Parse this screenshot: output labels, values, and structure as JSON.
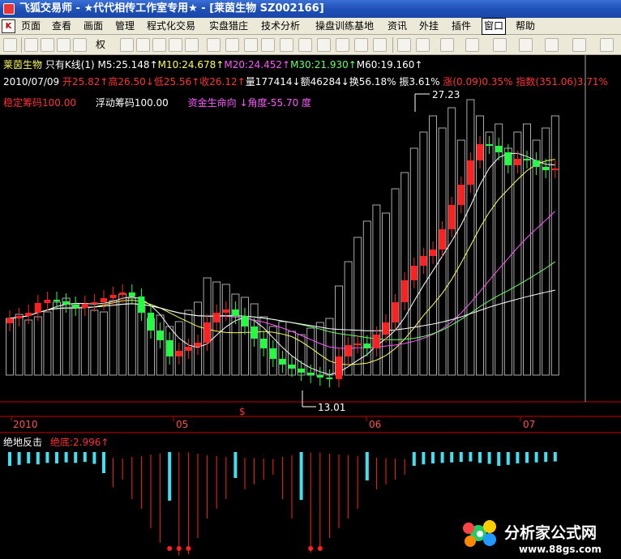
{
  "window": {
    "title": "飞狐交易师 - ★代代相传工作室专用★ - [莱茵生物 SZ002166]"
  },
  "menu": {
    "logo_text": "K",
    "items": [
      "页面",
      "查看",
      "画面",
      "管理",
      "程式化交易",
      "实盘猎庄",
      "技术分析",
      "操盘训练基地",
      "资讯",
      "外挂",
      "插件",
      "窗口",
      "帮助"
    ]
  },
  "toolbar": {
    "quan_label": "权",
    "icons": [
      "open-icon",
      "rsi-icon",
      "crosshair-icon",
      "move-icon",
      "weight-icon",
      "zoom-in-icon",
      "zoom-out-icon",
      "chart-icon",
      "bar-icon",
      "alarm-icon",
      "lock-icon",
      "paint-icon",
      "box-icon",
      "table-icon",
      "picture-icon",
      "cursor-icon",
      "line-icon",
      "ray-icon",
      "bars-icon",
      "fan-icon",
      "gann-icon",
      "arrow-icon",
      "rect-icon",
      "ellipse-icon",
      "pen-icon"
    ]
  },
  "stock": {
    "name": "莱茵生物",
    "mode": "只有K线(1)",
    "ma": [
      {
        "label": "M5:25.148↑",
        "color": "#ffffff"
      },
      {
        "label": "M10:24.678↑",
        "color": "#ffff50"
      },
      {
        "label": "M20:24.452↑",
        "color": "#ff55ff"
      },
      {
        "label": "M30:21.930↑",
        "color": "#66ff66"
      },
      {
        "label": "M60:19.160↑",
        "color": "#ffffff"
      }
    ]
  },
  "quote": {
    "date": "2010/07/09",
    "open": "开25.82↑",
    "high": "高26.50↓",
    "low": "低25.56↑",
    "close": "收26.12↑",
    "volume": "量177414↓",
    "amount": "额46284↓",
    "turnover": "换56.18%",
    "amplitude": "振3.61%",
    "change": "涨(0.09)0.35%",
    "index": "指数(351.06)3.71%"
  },
  "chips": {
    "stable": "稳定筹码100.00",
    "floating": "浮动筹码100.00",
    "lifeline": "资金生命向",
    "angle": "↓角度-55.70 度"
  },
  "annotations": {
    "high_price": "27.23",
    "low_price": "13.01",
    "marker": "$"
  },
  "time_axis": [
    "2010",
    "05",
    "06",
    "07"
  ],
  "indicator": {
    "name": "绝地反击",
    "value": "绝底:2.996↑"
  },
  "watermark": {
    "text": "分析家公式网",
    "url": "www.88gs.com"
  },
  "colors": {
    "up": "#ff2020",
    "down": "#20ff40",
    "cyan": "#40e0f0",
    "title_blue": "#1d4fb6"
  }
}
